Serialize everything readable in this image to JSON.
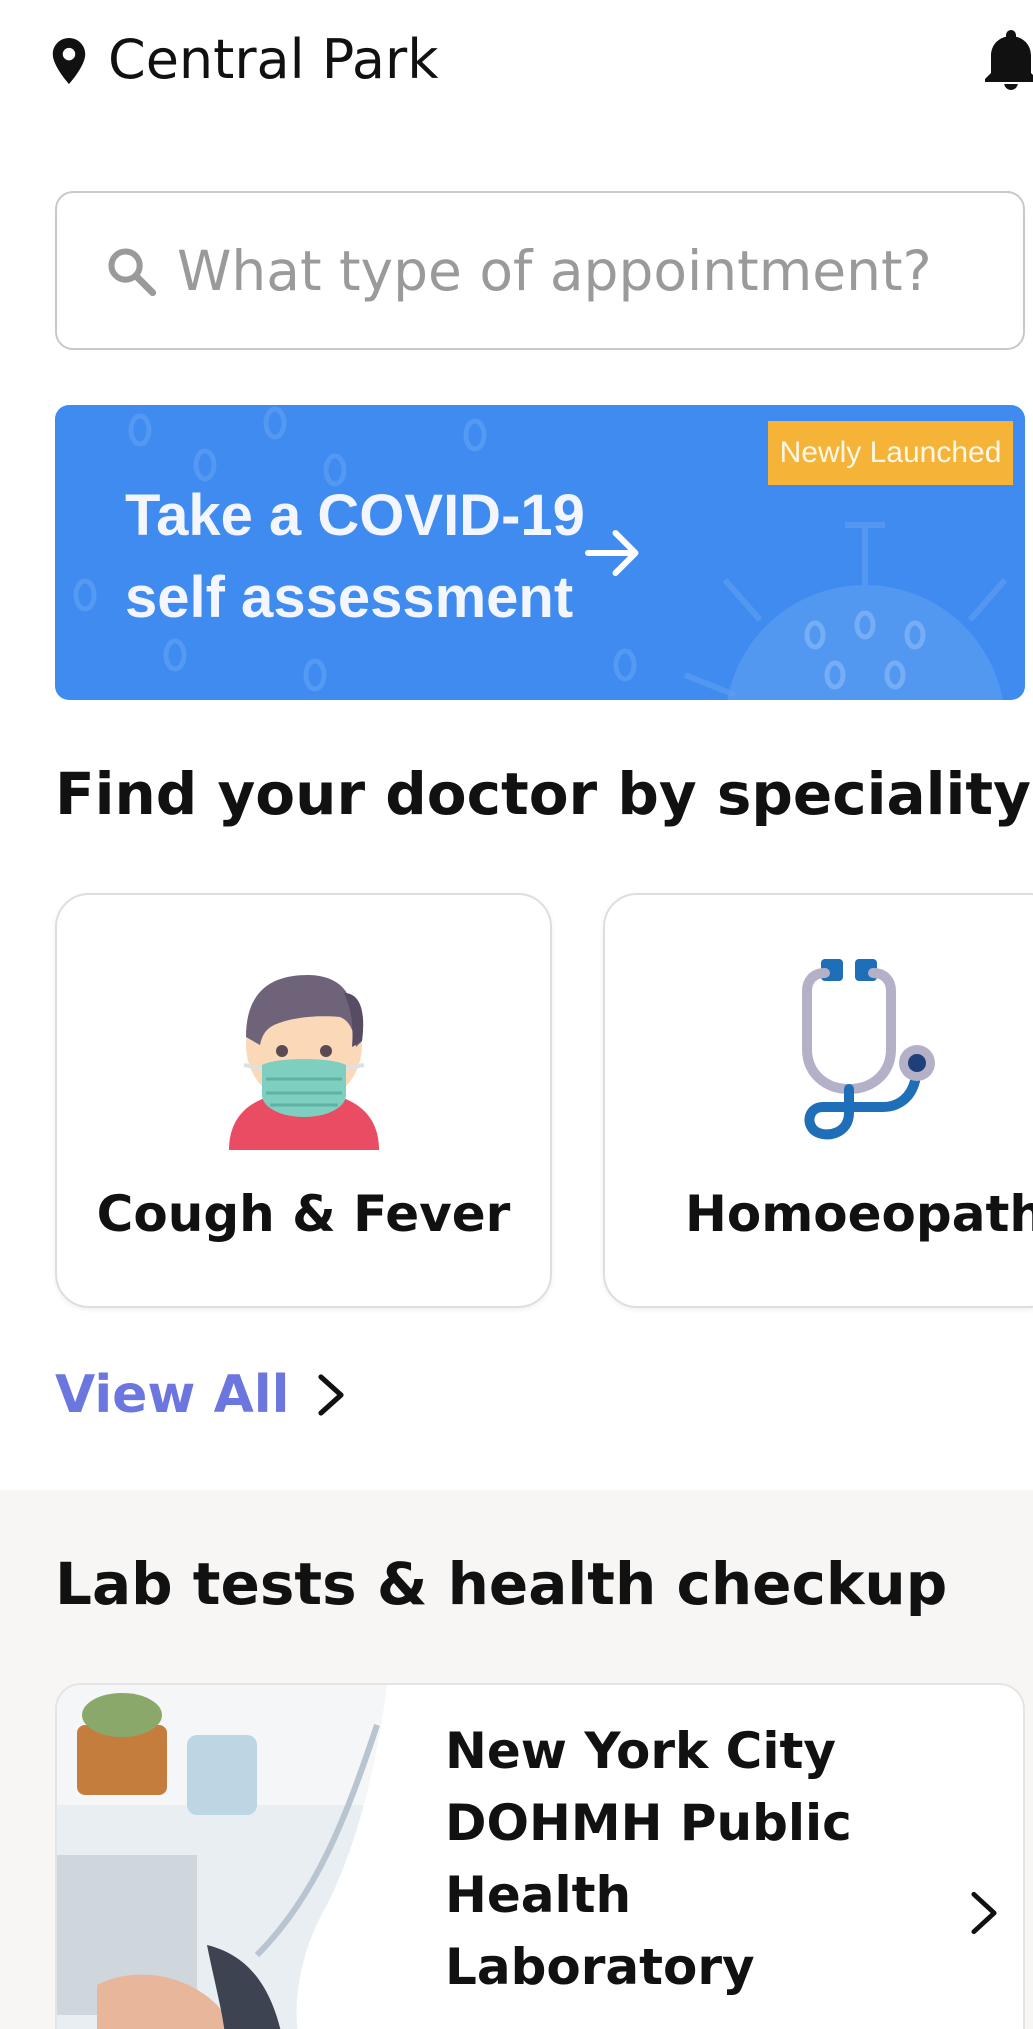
{
  "location": {
    "name": "Central Park"
  },
  "search": {
    "placeholder": "What type of appointment?"
  },
  "banner": {
    "title": "Take a COVID-19 self assessment",
    "badge": "Newly Launched",
    "color": "#3f8bef",
    "badge_color": "#f5b338"
  },
  "speciality": {
    "title": "Find your doctor by speciality",
    "items": [
      {
        "label": "Cough & Fever",
        "icon": "masked-person-icon"
      },
      {
        "label": "Homoeopath",
        "icon": "stethoscope-icon"
      }
    ],
    "view_all": "View All"
  },
  "labs": {
    "title": "Lab tests & health checkup",
    "items": [
      {
        "name": "New York City DOHMH Public Health Laboratory",
        "image": "doctor-photo"
      }
    ]
  },
  "colors": {
    "accent": "#6b77df",
    "section_bg": "#f7f6f5"
  }
}
